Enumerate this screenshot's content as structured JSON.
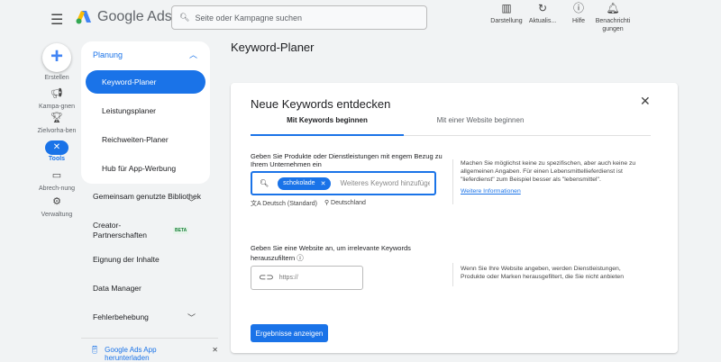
{
  "header": {
    "app_name": "Google Ads",
    "search_placeholder": "Seite oder Kampagne suchen",
    "actions": [
      {
        "label": "Darstellung",
        "icon": "appearance-icon"
      },
      {
        "label": "Aktualis...",
        "icon": "refresh-icon"
      },
      {
        "label": "Hilfe",
        "icon": "help-icon"
      },
      {
        "label": "Benachrichti gungen",
        "icon": "bell-icon"
      }
    ]
  },
  "rail": {
    "create": "Erstellen",
    "items": [
      {
        "label": "Kampa-gnen",
        "icon": "megaphone-icon"
      },
      {
        "label": "Zielvorha-ben",
        "icon": "trophy-icon"
      },
      {
        "label": "Tools",
        "icon": "tools-icon",
        "active": true
      },
      {
        "label": "Abrech-nung",
        "icon": "credit-card-icon"
      },
      {
        "label": "Verwaltung",
        "icon": "gear-icon"
      }
    ]
  },
  "nav": {
    "section": "Planung",
    "items": [
      "Keyword-Planer",
      "Leistungsplaner",
      "Reichweiten-Planer",
      "Hub für App-Werbung"
    ],
    "other": [
      "Gemeinsam genutzte Bibliothek",
      "Creator-Partnerschaften",
      "Eignung der Inhalte",
      "Data Manager",
      "Fehlerbehebung"
    ],
    "beta": "BETA",
    "download": "Google Ads App herunterladen"
  },
  "page": {
    "title": "Keyword-Planer"
  },
  "card": {
    "title": "Neue Keywords entdecken",
    "tabs": [
      "Mit Keywords beginnen",
      "Mit einer Website beginnen"
    ],
    "kw_label": "Geben Sie Produkte oder Dienstleistungen mit engem Bezug zu Ihrem Unternehmen ein",
    "chip": "schokolade",
    "kw_placeholder": "Weiteres Keyword hinzufügen",
    "language": "Deutsch (Standard)",
    "location": "Deutschland",
    "help1": "Machen Sie möglichst keine zu spezifischen, aber auch keine zu allgemeinen Angaben. Für einen Lebensmittellieferdienst ist \"lieferdienst\" zum Beispiel besser als \"lebensmittel\".",
    "help1_link": "Weitere Informationen",
    "site_label": "Geben Sie eine Website an, um irrelevante Keywords herauszufiltern",
    "url_placeholder": "https://",
    "help2": "Wenn Sie Ihre Website angeben, werden Dienstleistungen, Produkte oder Marken herausgefiltert, die Sie nicht anbieten",
    "submit": "Ergebnisse anzeigen"
  },
  "colors": {
    "accent": "#1a73e8",
    "background": "#f1f3f4"
  }
}
